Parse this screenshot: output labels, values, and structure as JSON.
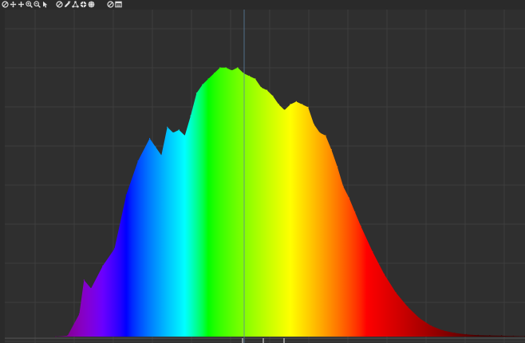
{
  "toolbar": {
    "buttons": [
      {
        "name": "reset-view-icon",
        "icon": "circle-slash"
      },
      {
        "name": "pan-icon",
        "icon": "four-way-arrow"
      },
      {
        "name": "crosshair-icon",
        "icon": "plus"
      },
      {
        "name": "zoom-in-icon",
        "icon": "magnifier-plus"
      },
      {
        "name": "zoom-out-icon",
        "icon": "magnifier-minus"
      },
      {
        "name": "select-cursor-icon",
        "icon": "pointer"
      },
      {
        "name": "clear-icon",
        "icon": "circle-slash"
      },
      {
        "name": "edit-icon",
        "icon": "pencil"
      },
      {
        "name": "peaks-icon",
        "icon": "triangle-nodes"
      },
      {
        "name": "color-wheel-icon",
        "icon": "wheel"
      },
      {
        "name": "sphere-icon",
        "icon": "sphere"
      },
      {
        "name": "disable-icon",
        "icon": "circle-slash"
      },
      {
        "name": "save-data-icon",
        "icon": "panel"
      }
    ]
  },
  "colors": {
    "background": "#2f2f2f",
    "grid": "#3d3d3d",
    "marker_line": "#5a7fa0"
  },
  "chart_data": {
    "type": "area",
    "title": "",
    "xlabel": "",
    "ylabel": "",
    "grid": true,
    "x_unit": "nm",
    "xlim": [
      380,
      780
    ],
    "ylim": [
      0,
      1
    ],
    "fill": "wavelength-gradient",
    "x": [
      380,
      390,
      400,
      404,
      410,
      420,
      430,
      440,
      450,
      460,
      465,
      470,
      475,
      480,
      485,
      490,
      495,
      500,
      505,
      510,
      515,
      520,
      525,
      530,
      535,
      540,
      545,
      550,
      555,
      560,
      565,
      570,
      575,
      580,
      585,
      590,
      595,
      600,
      605,
      610,
      615,
      620,
      625,
      630,
      635,
      640,
      650,
      660,
      670,
      680,
      690,
      700,
      710,
      720,
      730,
      740,
      750,
      760,
      770,
      780
    ],
    "values": [
      0.0,
      0.003,
      0.08,
      0.2,
      0.17,
      0.25,
      0.31,
      0.5,
      0.62,
      0.7,
      0.67,
      0.64,
      0.74,
      0.72,
      0.73,
      0.71,
      0.78,
      0.86,
      0.89,
      0.91,
      0.93,
      0.95,
      0.95,
      0.94,
      0.95,
      0.93,
      0.92,
      0.91,
      0.88,
      0.87,
      0.85,
      0.82,
      0.8,
      0.82,
      0.83,
      0.82,
      0.81,
      0.75,
      0.72,
      0.71,
      0.66,
      0.6,
      0.53,
      0.49,
      0.44,
      0.39,
      0.3,
      0.22,
      0.155,
      0.105,
      0.065,
      0.038,
      0.022,
      0.013,
      0.008,
      0.005,
      0.004,
      0.003,
      0.002,
      0.001
    ]
  }
}
